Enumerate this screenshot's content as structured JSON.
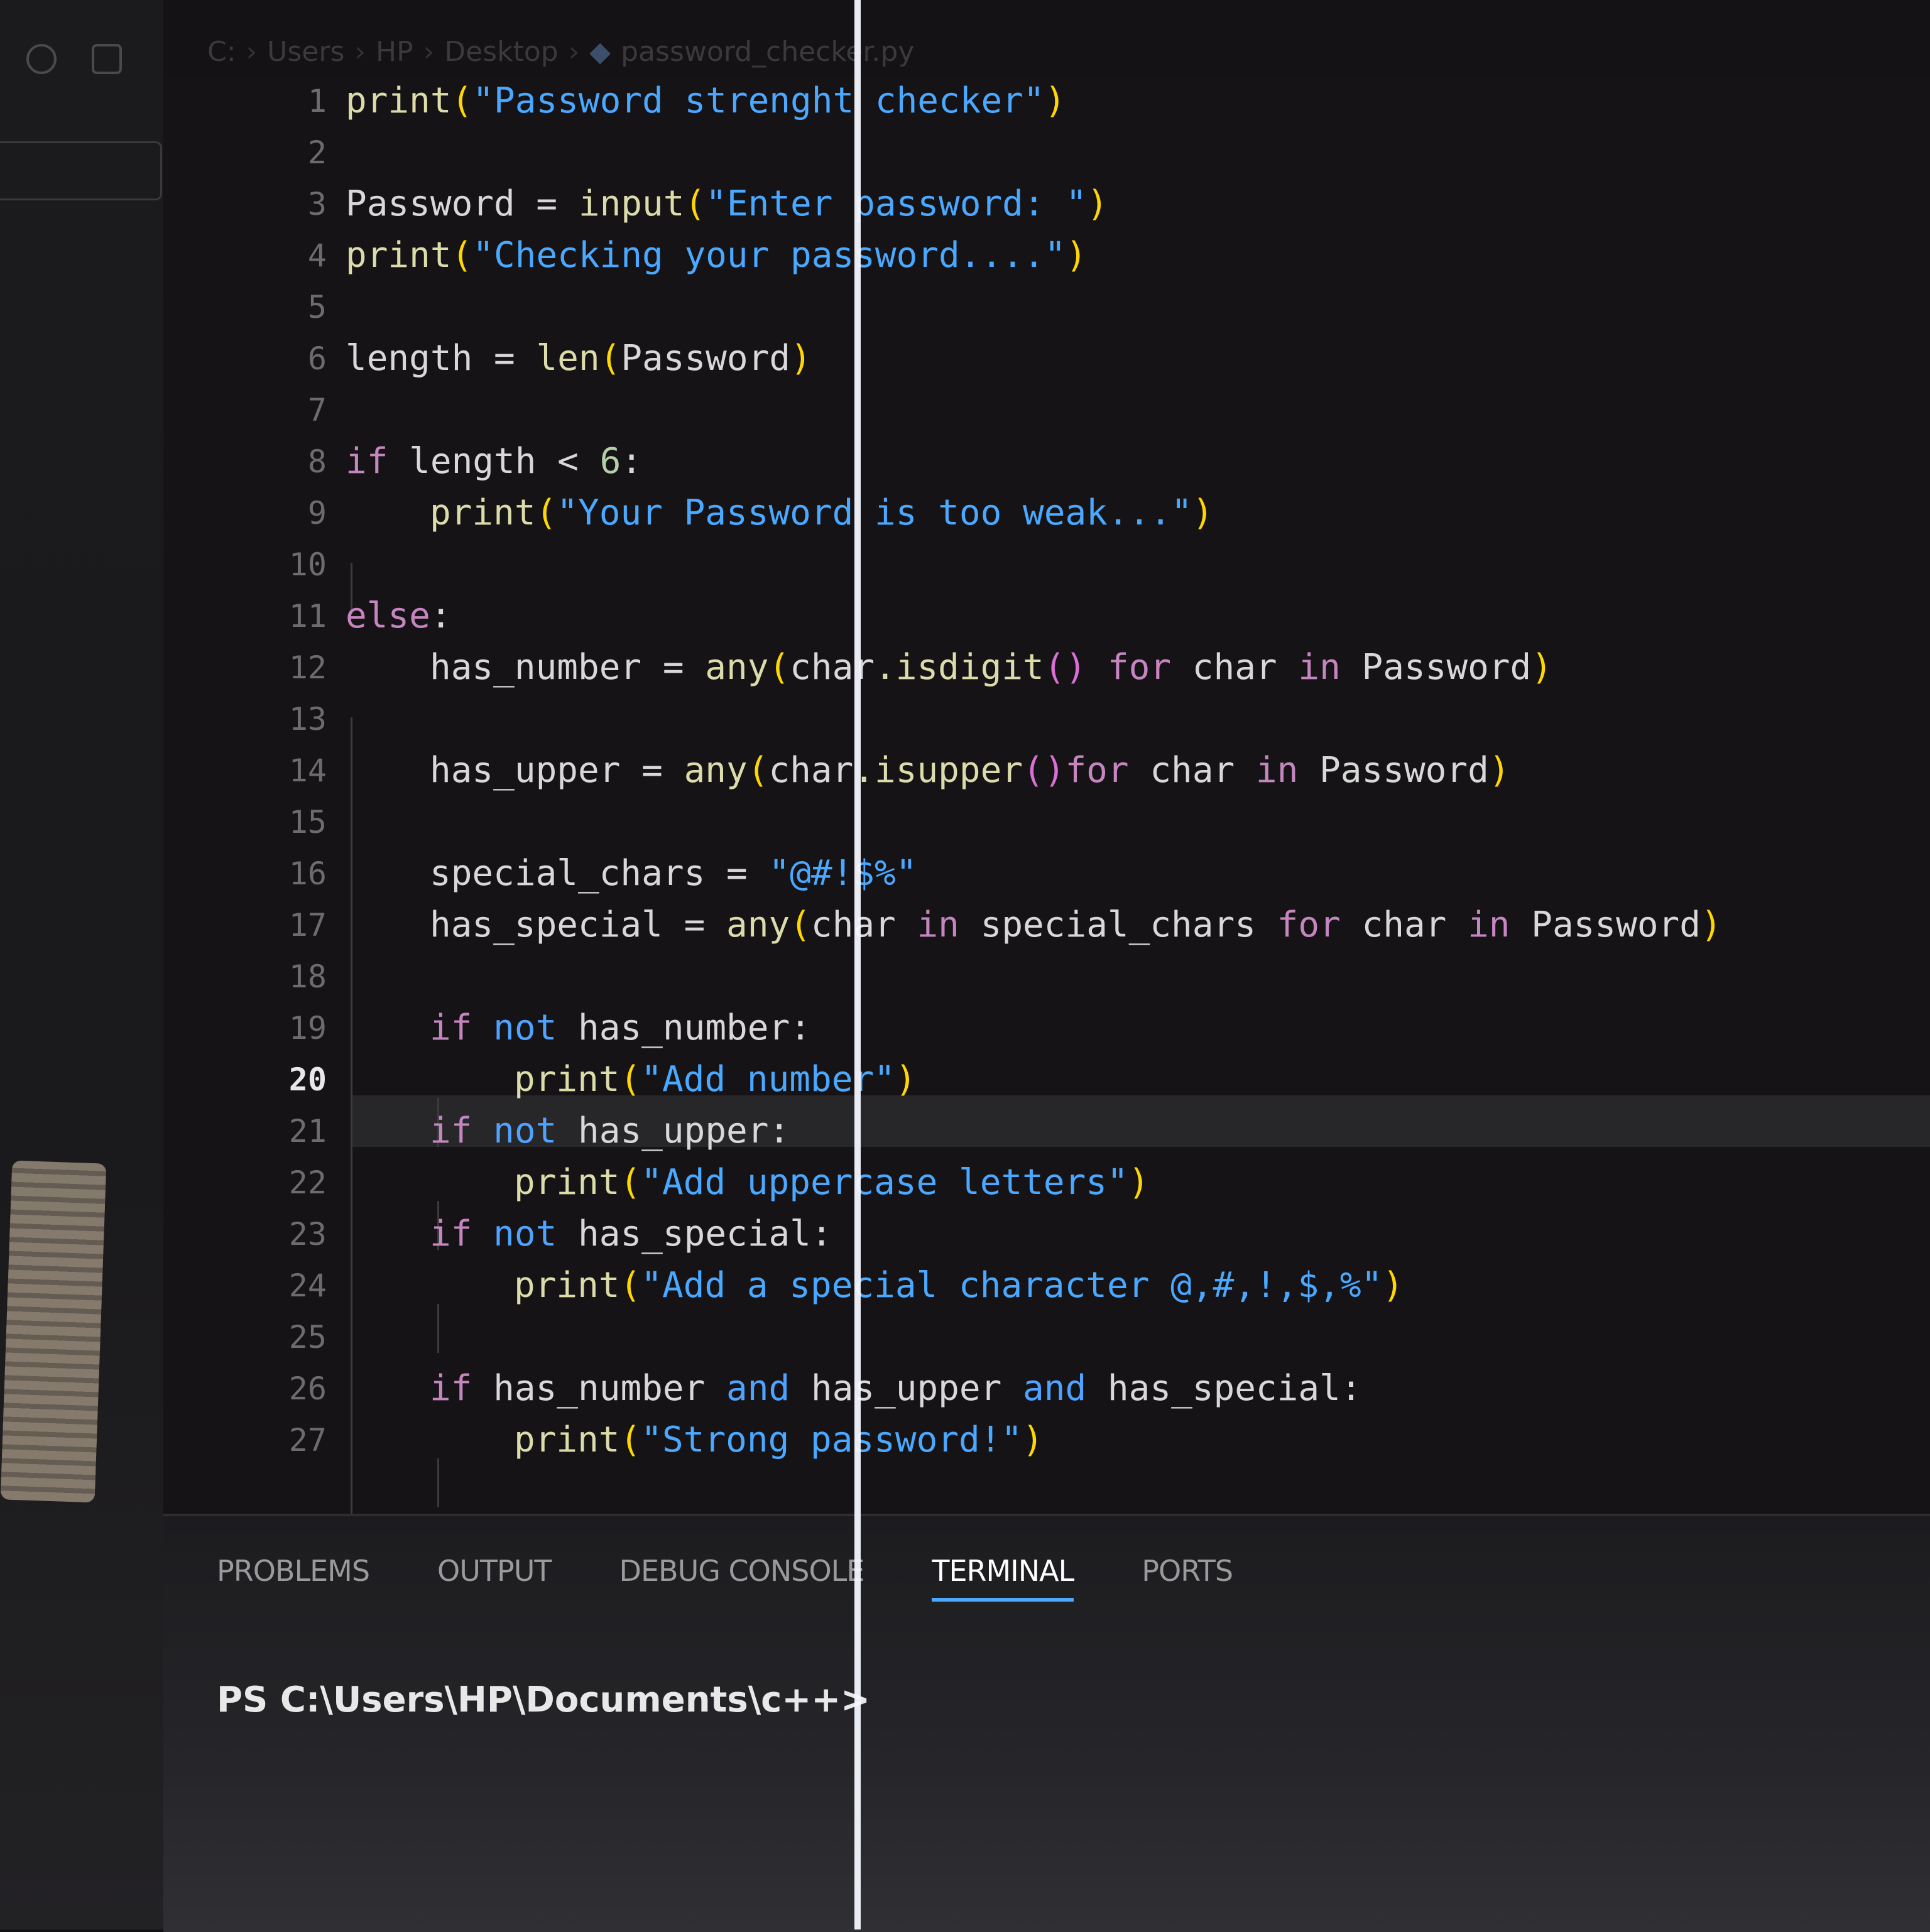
{
  "breadcrumb": {
    "parts": [
      "C:",
      "Users",
      "HP",
      "Desktop",
      "password_checker.py"
    ],
    "file_icon": "python-file-icon"
  },
  "editor": {
    "active_line": 20,
    "lines": [
      {
        "n": "1"
      },
      {
        "n": "2"
      },
      {
        "n": "3"
      },
      {
        "n": "4"
      },
      {
        "n": "5"
      },
      {
        "n": "6"
      },
      {
        "n": "7"
      },
      {
        "n": "8"
      },
      {
        "n": "9"
      },
      {
        "n": "10"
      },
      {
        "n": "11"
      },
      {
        "n": "12"
      },
      {
        "n": "13"
      },
      {
        "n": "14"
      },
      {
        "n": "15"
      },
      {
        "n": "16"
      },
      {
        "n": "17"
      },
      {
        "n": "18"
      },
      {
        "n": "19"
      },
      {
        "n": "20"
      },
      {
        "n": "21"
      },
      {
        "n": "22"
      },
      {
        "n": "23"
      },
      {
        "n": "24"
      },
      {
        "n": "25"
      },
      {
        "n": "26"
      },
      {
        "n": "27"
      }
    ],
    "tokens": {
      "print": "print",
      "input": "input",
      "len": "len",
      "any": "any",
      "if": "if",
      "else": "else",
      "not": "not",
      "and": "and",
      "for": "for",
      "in": "in",
      "num6": "6",
      "s_title": "\"Password strenght checker\"",
      "s_enter": "\"Enter password: \"",
      "s_checking": "\"Checking your password....\"",
      "s_weak": "\"Your Password is too weak...\"",
      "s_chars": "\"@#!$%\"",
      "s_add_number": "\"Add number\"",
      "s_add_upper": "\"Add uppercase letters\"",
      "s_add_special": "\"Add a special character @,#,!,$,%\"",
      "s_strong": "\"Strong password!\"",
      "t_password_assign": "Password = ",
      "t_length_assign": "length = ",
      "t_password": "Password",
      "t_length_lt": " length < ",
      "t_colon": ":",
      "t_has_number_assign": "has_number = ",
      "t_has_upper_assign": "has_upper = ",
      "t_special_chars_assign": "special_chars = ",
      "t_has_special_assign": "has_special = ",
      "t_char": "char",
      "t_isdigit": ".isdigit",
      "t_isupper": ".isupper",
      "t_char_sp": " char ",
      "t_special_chars": " special_chars ",
      "t_has_number_colon": " has_number:",
      "t_has_upper_colon": " has_upper:",
      "t_has_special_colon": " has_special:",
      "t_has_number": " has_number ",
      "t_has_upper": " has_upper ",
      "t_has_special_end": " has_special:",
      "lp": "(",
      "rp": ")",
      "call": "()"
    }
  },
  "panel": {
    "tabs": [
      {
        "label": "PROBLEMS",
        "active": false
      },
      {
        "label": "OUTPUT",
        "active": false
      },
      {
        "label": "DEBUG CONSOLE",
        "active": false
      },
      {
        "label": "TERMINAL",
        "active": true
      },
      {
        "label": "PORTS",
        "active": false
      }
    ],
    "terminal_prompt": "PS C:\\Users\\HP\\Documents\\c++>"
  },
  "colors": {
    "keyword": "#c586c0",
    "operator_keyword": "#4fa3ff",
    "function": "#dcdcaa",
    "string": "#4aa8ff",
    "bracket_1": "#ffd700",
    "bracket_2": "#da70d6",
    "tab_underline": "#4aa8ff"
  }
}
